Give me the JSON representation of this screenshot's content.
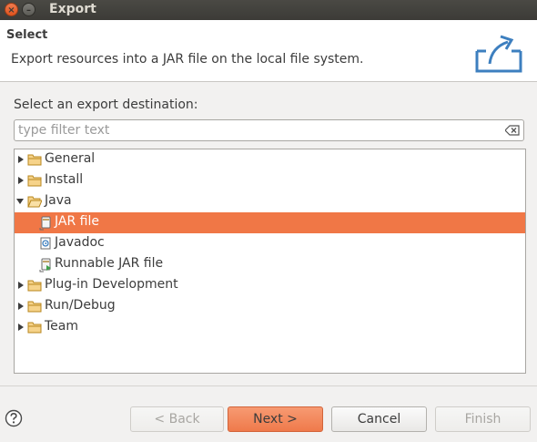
{
  "window": {
    "title": "Export",
    "close_glyph": "×",
    "minimize_glyph": "–"
  },
  "header": {
    "title": "Select",
    "description": "Export resources into a JAR file on the local file system."
  },
  "destination_label": "Select an export destination:",
  "filter": {
    "placeholder": "type filter text",
    "value": ""
  },
  "tree": {
    "items": [
      {
        "label": "General",
        "type": "folder",
        "expanded": false
      },
      {
        "label": "Install",
        "type": "folder",
        "expanded": false
      },
      {
        "label": "Java",
        "type": "folder",
        "expanded": true
      },
      {
        "label": "JAR file",
        "type": "jar-file",
        "selected": true
      },
      {
        "label": "Javadoc",
        "type": "javadoc"
      },
      {
        "label": "Runnable JAR file",
        "type": "runnable-jar"
      },
      {
        "label": "Plug-in Development",
        "type": "folder",
        "expanded": false
      },
      {
        "label": "Run/Debug",
        "type": "folder",
        "expanded": false
      },
      {
        "label": "Team",
        "type": "folder",
        "expanded": false
      }
    ]
  },
  "buttons": {
    "back": "< Back",
    "next": "Next >",
    "cancel": "Cancel",
    "finish": "Finish"
  },
  "colors": {
    "selection": "#f07746",
    "accent": "#ef7a4b"
  }
}
